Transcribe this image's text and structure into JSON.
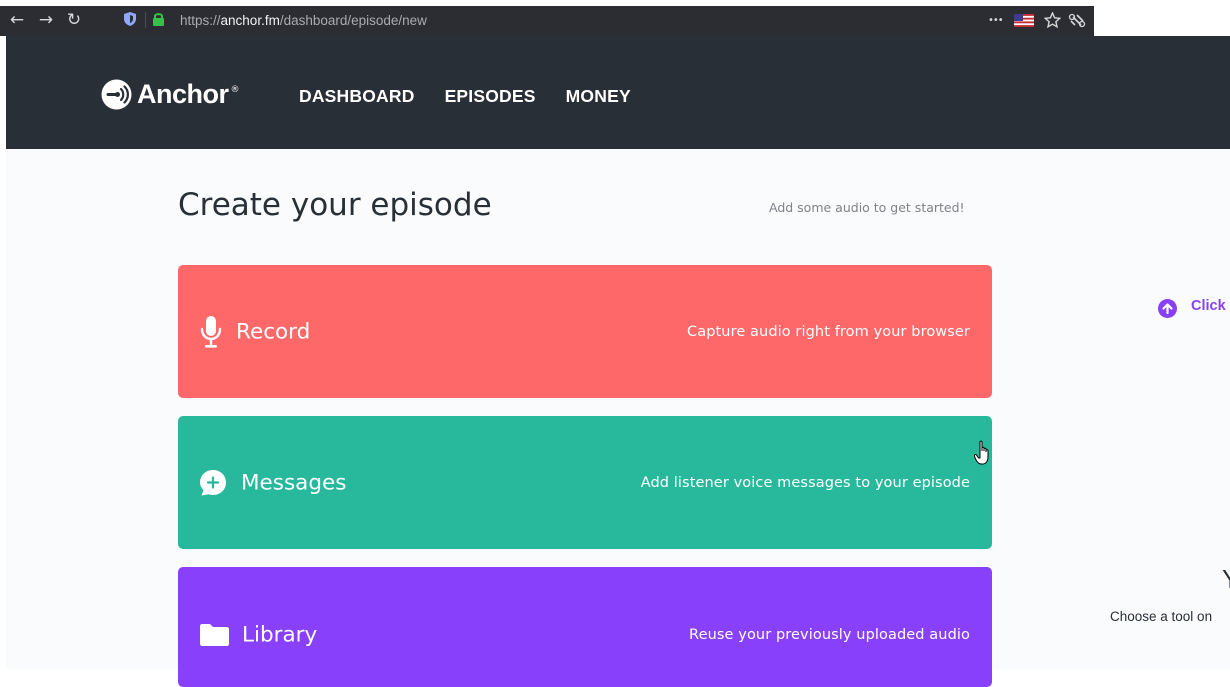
{
  "browser": {
    "back_icon": "arrow-left-icon",
    "forward_icon": "arrow-right-icon",
    "reload_icon": "reload-icon",
    "url_prefix": "https://",
    "url_host": "anchor.fm",
    "url_path": "/dashboard/episode/new",
    "more_label": "•••"
  },
  "header": {
    "brand": "Anchor",
    "brand_mark": "®",
    "nav": [
      "DASHBOARD",
      "EPISODES",
      "MONEY"
    ]
  },
  "main": {
    "title": "Create your episode",
    "hint": "Add some audio to get started!",
    "tools": [
      {
        "title": "Record",
        "description": "Capture audio right from your browser",
        "color": "#ff6869",
        "icon": "microphone-icon"
      },
      {
        "title": "Messages",
        "description": "Add listener voice messages to your episode",
        "color": "#28b99d",
        "icon": "add-message-icon"
      },
      {
        "title": "Library",
        "description": "Reuse your previously uploaded audio",
        "color": "#8940fa",
        "icon": "folder-icon"
      }
    ]
  },
  "side": {
    "upload_hint": "Click",
    "letter": "Y",
    "sub": "Choose a tool on"
  },
  "colors": {
    "header_bg": "#292f36",
    "accent_purple": "#8940fa"
  }
}
